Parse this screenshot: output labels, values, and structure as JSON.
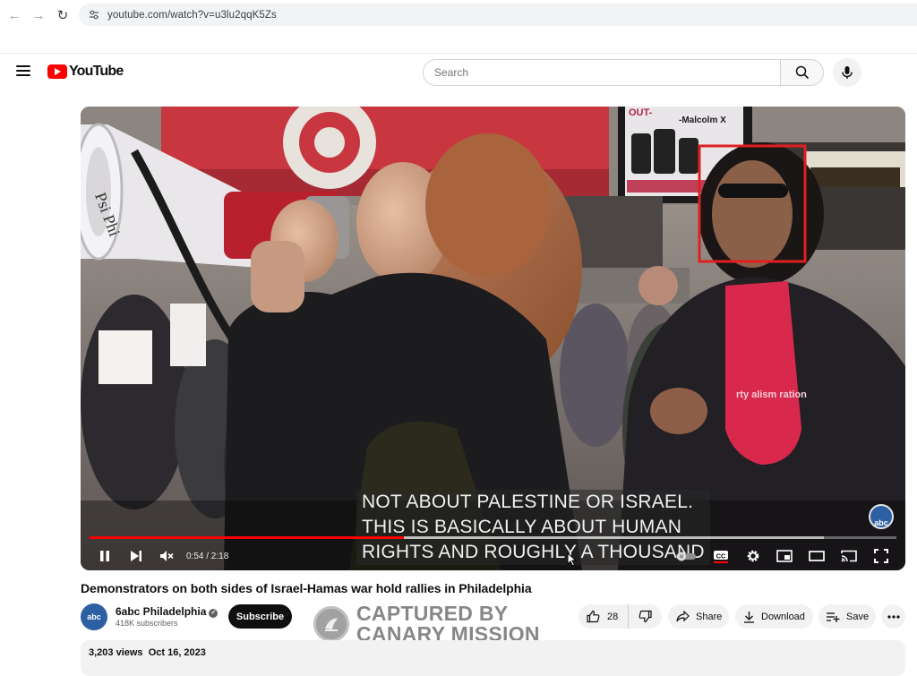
{
  "browser": {
    "url": "youtube.com/watch?v=u3lu2qqK5Zs"
  },
  "header": {
    "logo_text": "YouTube",
    "search_placeholder": "Search"
  },
  "player": {
    "subtitle_lines": [
      "NOT ABOUT PALESTINE OR ISRAEL.",
      "THIS IS BASICALLY ABOUT HUMAN",
      "RIGHTS AND ROUGHLY A THOUSAND"
    ],
    "time": "0:54 / 2:18",
    "progress_played": 0.39,
    "progress_buffered": 0.91,
    "scene_text": {
      "poster_top": "OUT-",
      "poster_author": "-Malcolm X",
      "megaphone_tag": "Psi Phi",
      "shirt_text": "rty alism ration"
    },
    "icons": [
      "pause-icon",
      "next-icon",
      "mute-icon",
      "autoplay-toggle",
      "cc-icon",
      "settings-icon",
      "miniplayer-icon",
      "theater-icon",
      "cast-icon",
      "fullscreen-icon"
    ],
    "bug": "abc"
  },
  "video": {
    "title": "Demonstrators on both sides of Israel-Hamas war hold rallies in Philadelphia",
    "channel_name": "6abc Philadelphia",
    "subscribers": "418K subscribers",
    "subscribe_label": "Subscribe",
    "like_count": "28",
    "share_label": "Share",
    "download_label": "Download",
    "save_label": "Save",
    "views": "3,203 views",
    "date": "Oct 16, 2023"
  },
  "watermark": {
    "line1": "CAPTURED BY",
    "line2": "CANARY MISSION"
  },
  "colors": {
    "youtube_red": "#ff0000",
    "highlight_box": "#e02020",
    "target_red": "#d0112b"
  }
}
